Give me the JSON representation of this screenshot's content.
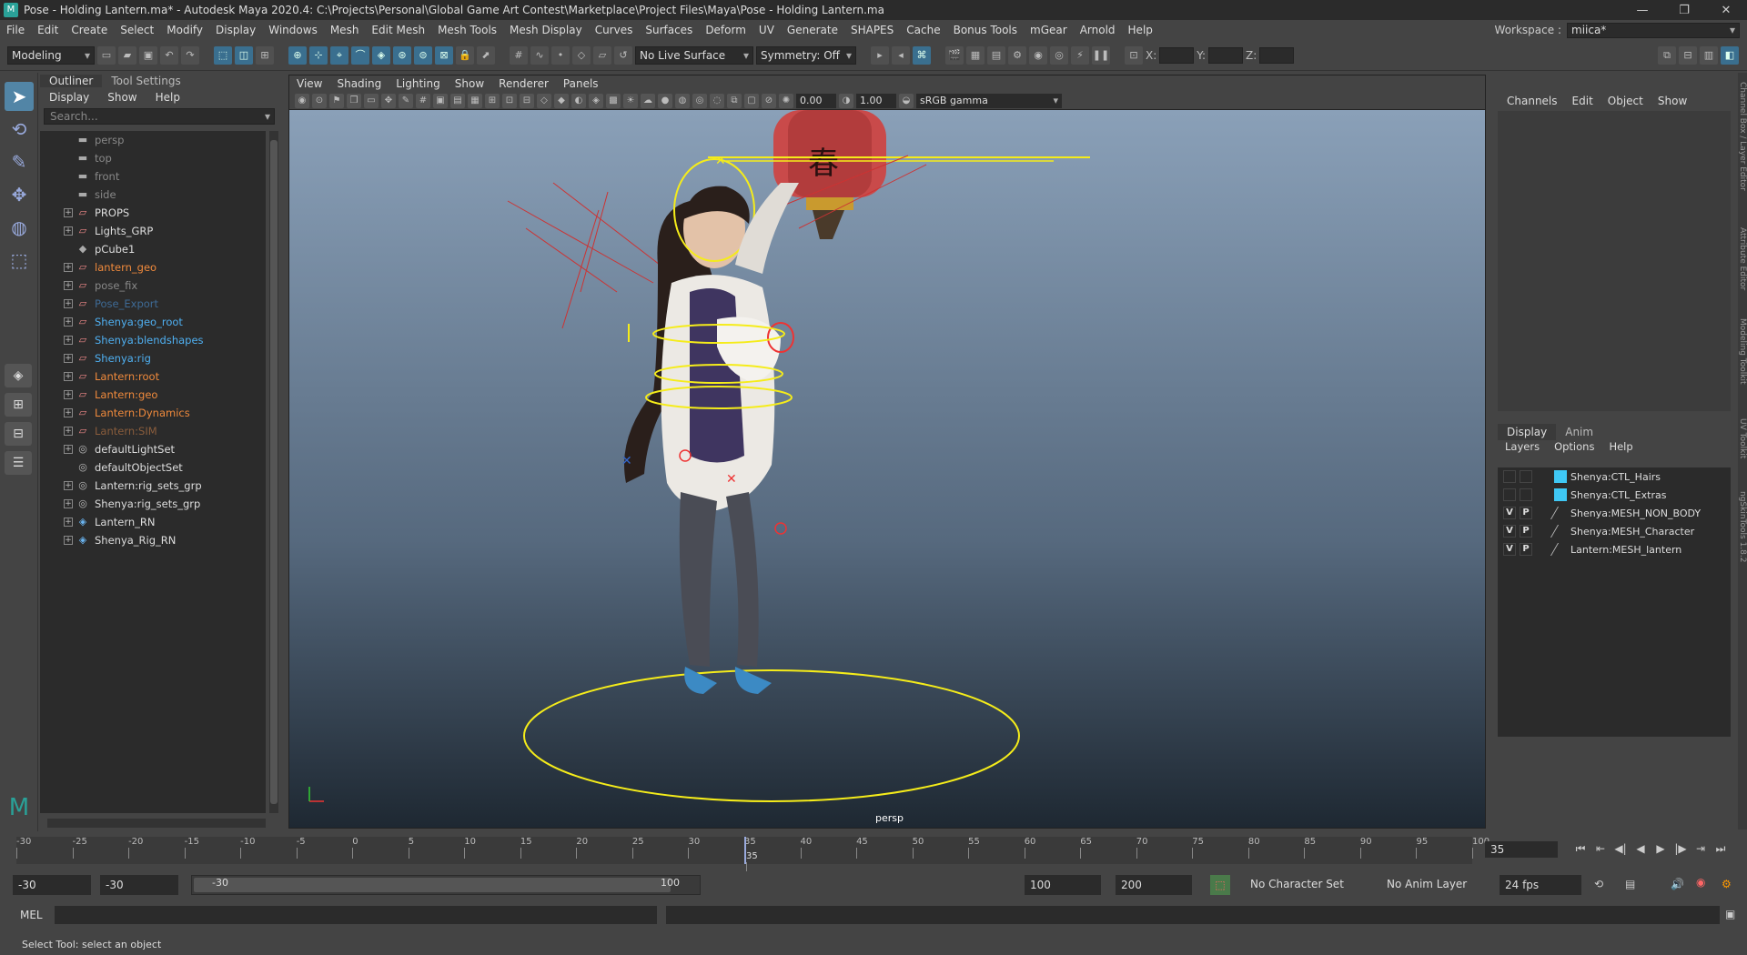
{
  "titlebar": {
    "title": "Pose - Holding Lantern.ma* - Autodesk Maya 2020.4: C:\\Projects\\Personal\\Global Game Art Contest\\Marketplace\\Project Files\\Maya\\Pose - Holding Lantern.ma"
  },
  "menubar": {
    "items": [
      "File",
      "Edit",
      "Create",
      "Select",
      "Modify",
      "Display",
      "Windows",
      "Mesh",
      "Edit Mesh",
      "Mesh Tools",
      "Mesh Display",
      "Curves",
      "Surfaces",
      "Deform",
      "UV",
      "Generate",
      "SHAPES",
      "Cache",
      "Bonus Tools",
      "mGear",
      "Arnold",
      "Help"
    ],
    "workspace_label": "Workspace :",
    "workspace_value": "miica*"
  },
  "shelf": {
    "mode": "Modeling",
    "live_surface": "No Live Surface",
    "symmetry": "Symmetry: Off",
    "x": "X:",
    "y": "Y:",
    "z": "Z:"
  },
  "outliner": {
    "tab1": "Outliner",
    "tab2": "Tool Settings",
    "menu": [
      "Display",
      "Show",
      "Help"
    ],
    "search_placeholder": "Search...",
    "items": [
      {
        "label": "persp",
        "color": "grey",
        "icon": "camera-icon",
        "expandable": false
      },
      {
        "label": "top",
        "color": "grey",
        "icon": "camera-icon",
        "expandable": false
      },
      {
        "label": "front",
        "color": "grey",
        "icon": "camera-icon",
        "expandable": false
      },
      {
        "label": "side",
        "color": "grey",
        "icon": "camera-icon",
        "expandable": false
      },
      {
        "label": "PROPS",
        "color": "white",
        "icon": "group-icon",
        "expandable": true
      },
      {
        "label": "Lights_GRP",
        "color": "white",
        "icon": "group-icon",
        "expandable": true
      },
      {
        "label": "pCube1",
        "color": "white",
        "icon": "mesh-icon",
        "expandable": false
      },
      {
        "label": "lantern_geo",
        "color": "orange",
        "icon": "group-icon",
        "expandable": true
      },
      {
        "label": "pose_fix",
        "color": "grey",
        "icon": "group-icon",
        "expandable": true
      },
      {
        "label": "Pose_Export",
        "color": "dblue",
        "icon": "group-icon",
        "expandable": true
      },
      {
        "label": "Shenya:geo_root",
        "color": "blue",
        "icon": "group-icon",
        "expandable": true
      },
      {
        "label": "Shenya:blendshapes",
        "color": "blue",
        "icon": "group-icon",
        "expandable": true
      },
      {
        "label": "Shenya:rig",
        "color": "blue",
        "icon": "group-icon",
        "expandable": true
      },
      {
        "label": "Lantern:root",
        "color": "orange",
        "icon": "group-icon",
        "expandable": true
      },
      {
        "label": "Lantern:geo",
        "color": "orange",
        "icon": "group-icon",
        "expandable": true
      },
      {
        "label": "Lantern:Dynamics",
        "color": "orange",
        "icon": "group-icon",
        "expandable": true
      },
      {
        "label": "Lantern:SIM",
        "color": "brown",
        "icon": "group-icon",
        "expandable": true
      },
      {
        "label": "defaultLightSet",
        "color": "white",
        "icon": "set-icon",
        "expandable": true
      },
      {
        "label": "defaultObjectSet",
        "color": "white",
        "icon": "set-icon",
        "expandable": false
      },
      {
        "label": "Lantern:rig_sets_grp",
        "color": "white",
        "icon": "set-icon",
        "expandable": true
      },
      {
        "label": "Shenya:rig_sets_grp",
        "color": "white",
        "icon": "set-icon",
        "expandable": true
      },
      {
        "label": "Lantern_RN",
        "color": "white",
        "icon": "reference-icon",
        "expandable": true
      },
      {
        "label": "Shenya_Rig_RN",
        "color": "white",
        "icon": "reference-icon",
        "expandable": true
      }
    ]
  },
  "viewport": {
    "menu": [
      "View",
      "Shading",
      "Lighting",
      "Show",
      "Renderer",
      "Panels"
    ],
    "exposure": "0.00",
    "gamma": "1.00",
    "colorspace": "sRGB gamma",
    "camera": "persp"
  },
  "channelbox": {
    "menu": [
      "Channels",
      "Edit",
      "Object",
      "Show"
    ]
  },
  "layereditor": {
    "tabs": [
      "Display",
      "Anim"
    ],
    "menu": [
      "Layers",
      "Options",
      "Help"
    ],
    "layers": [
      {
        "v": "",
        "p": "",
        "color": "#3fc8f5",
        "name": "Shenya:CTL_Hairs"
      },
      {
        "v": "",
        "p": "",
        "color": "#3fc8f5",
        "name": "Shenya:CTL_Extras"
      },
      {
        "v": "V",
        "p": "P",
        "color": "",
        "name": "Shenya:MESH_NON_BODY"
      },
      {
        "v": "V",
        "p": "P",
        "color": "",
        "name": "Shenya:MESH_Character"
      },
      {
        "v": "V",
        "p": "P",
        "color": "",
        "name": "Lantern:MESH_lantern"
      }
    ]
  },
  "sidetabs": [
    "Channel Box / Layer Editor",
    "Attribute Editor",
    "Modeling Toolkit",
    "UV Toolkit",
    "ngSkinTools 1.8.2"
  ],
  "timeslider": {
    "ticks": [
      "-30",
      "-25",
      "-20",
      "-15",
      "-10",
      "-5",
      "0",
      "5",
      "10",
      "15",
      "20",
      "25",
      "30",
      "35",
      "40",
      "45",
      "50",
      "55",
      "60",
      "65",
      "70",
      "75",
      "80",
      "85",
      "90",
      "95",
      "100"
    ],
    "current": "35",
    "current_frame": "35"
  },
  "range": {
    "start": "-30",
    "anim_start": "-30",
    "slider_start": "-30",
    "slider_end": "100",
    "anim_end": "100",
    "end": "200",
    "character_set": "No Character Set",
    "anim_layer": "No Anim Layer",
    "fps": "24 fps"
  },
  "cmdline": {
    "label": "MEL"
  },
  "helpline": {
    "text": "Select Tool: select an object"
  },
  "lantern_text": "春"
}
